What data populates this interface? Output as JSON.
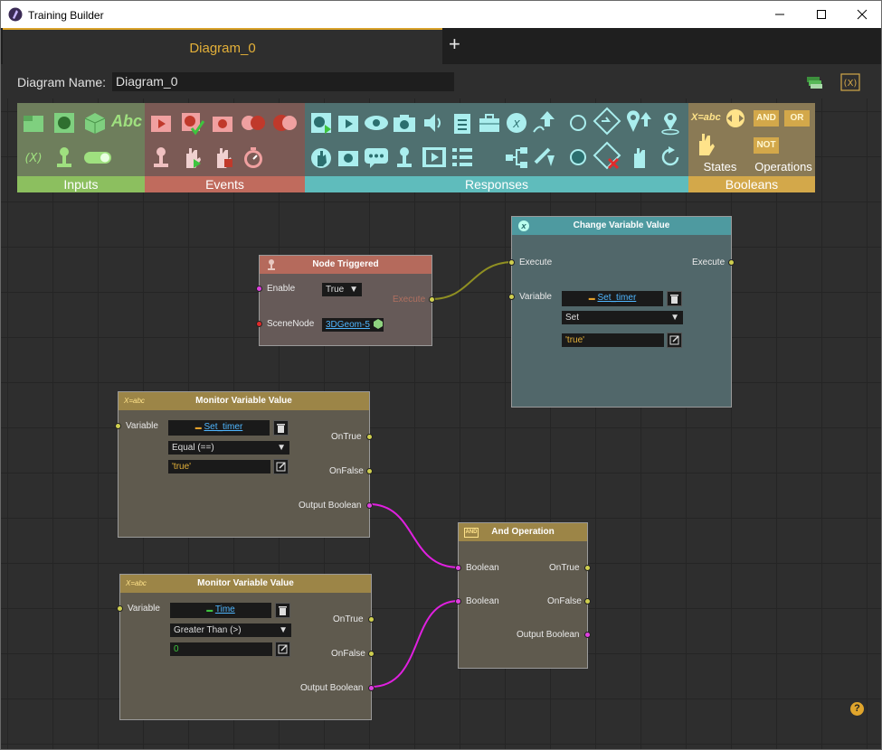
{
  "window": {
    "title": "Training Builder"
  },
  "tabs": [
    {
      "label": "Diagram_0"
    }
  ],
  "add_tab": "+",
  "name_bar": {
    "label": "Diagram Name:",
    "value": "Diagram_0"
  },
  "palette": {
    "inputs": "Inputs",
    "events": "Events",
    "responses": "Responses",
    "booleans": "Booleans",
    "states": "States",
    "operations": "Operations",
    "abc": "Abc",
    "and": "AND",
    "or": "OR",
    "not": "NOT",
    "xabc": "X=abc"
  },
  "nodes": {
    "node_triggered": {
      "title": "Node Triggered",
      "enable": "Enable",
      "enable_value": "True",
      "execute": "Execute",
      "scene_node": "SceneNode",
      "scene_value": "3DGeom-5"
    },
    "change_var": {
      "title": "Change Variable Value",
      "execute_in": "Execute",
      "execute_out": "Execute",
      "variable": "Variable",
      "var_value": "Set_timer",
      "op": "Set",
      "value": "'true'"
    },
    "monitor1": {
      "title": "Monitor Variable Value",
      "variable": "Variable",
      "var_value": "Set_timer",
      "cond": "Equal (==)",
      "value": "'true'",
      "on_true": "OnTrue",
      "on_false": "OnFalse",
      "out": "Output Boolean"
    },
    "monitor2": {
      "title": "Monitor Variable Value",
      "variable": "Variable",
      "var_value": "Time",
      "cond": "Greater Than (>)",
      "value": "0",
      "on_true": "OnTrue",
      "on_false": "OnFalse",
      "out": "Output Boolean"
    },
    "and_op": {
      "title": "And Operation",
      "in1": "Boolean",
      "in2": "Boolean",
      "on_true": "OnTrue",
      "on_false": "OnFalse",
      "out": "Output Boolean"
    }
  },
  "help": "?",
  "colors": {
    "accent": "#e3b039",
    "inputs": "#8cbf5f",
    "events": "#c06b5d",
    "responses": "#5fbcbc",
    "booleans": "#d3a84a"
  }
}
